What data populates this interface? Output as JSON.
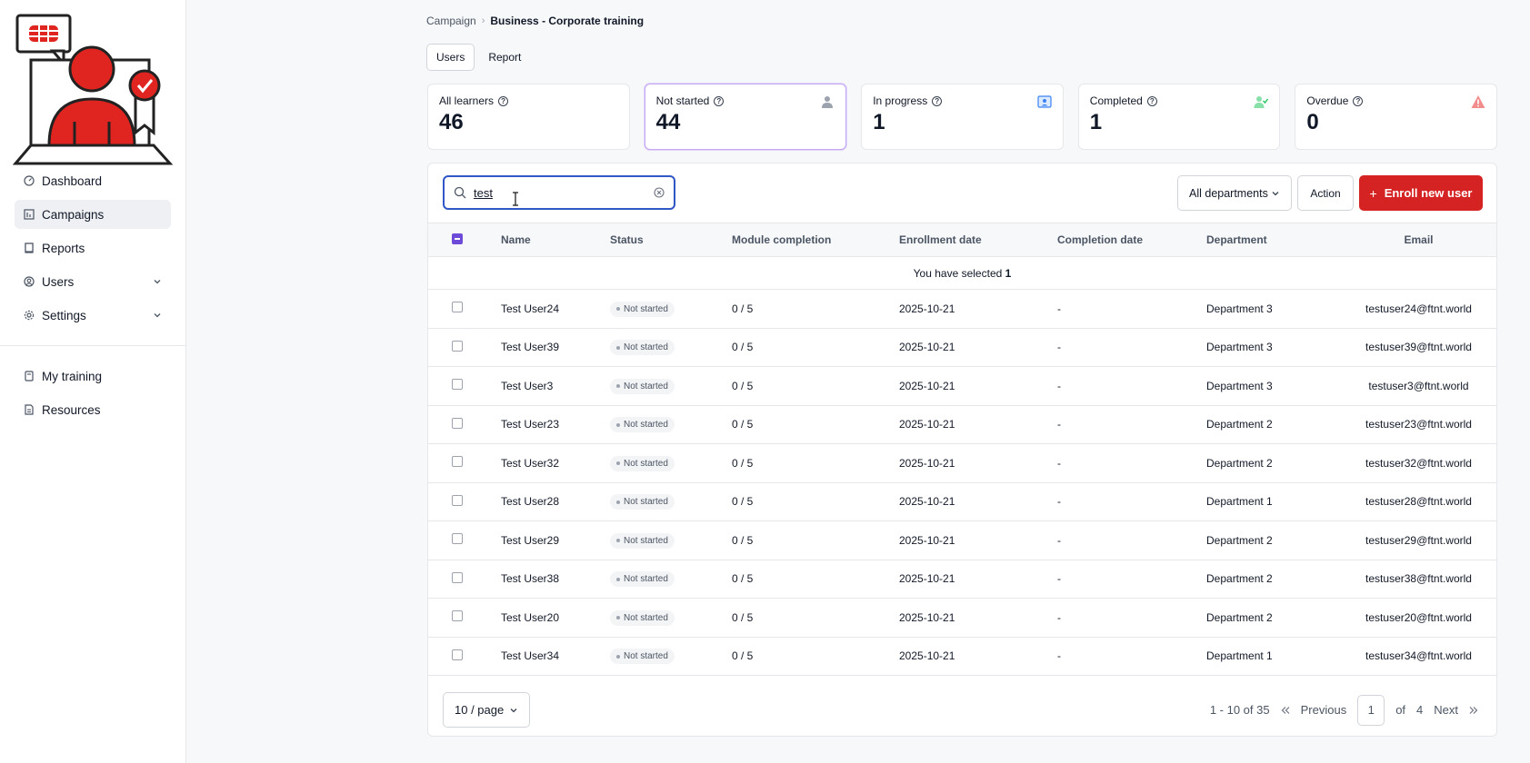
{
  "sidebar": {
    "items": [
      {
        "label": "Dashboard",
        "icon": "dashboard-icon"
      },
      {
        "label": "Campaigns",
        "icon": "campaigns-icon",
        "active": true
      },
      {
        "label": "Reports",
        "icon": "reports-icon"
      },
      {
        "label": "Users",
        "icon": "users-icon",
        "expandable": true
      },
      {
        "label": "Settings",
        "icon": "settings-icon",
        "expandable": true
      }
    ],
    "secondary": [
      {
        "label": "My training",
        "icon": "book-icon"
      },
      {
        "label": "Resources",
        "icon": "resources-icon"
      }
    ]
  },
  "breadcrumb": {
    "root": "Campaign",
    "current": "Business - Corporate training"
  },
  "tabs": [
    {
      "label": "Users",
      "active": true
    },
    {
      "label": "Report"
    }
  ],
  "stats": [
    {
      "label": "All learners",
      "value": "46"
    },
    {
      "label": "Not started",
      "value": "44",
      "icon": "user-icon"
    },
    {
      "label": "In progress",
      "value": "1",
      "icon": "user-card-icon"
    },
    {
      "label": "Completed",
      "value": "1",
      "icon": "user-check-icon"
    },
    {
      "label": "Overdue",
      "value": "0",
      "icon": "warning-icon"
    }
  ],
  "search": {
    "value": "test"
  },
  "filters": {
    "department": "All departments",
    "action": "Action",
    "enroll": "Enroll new user"
  },
  "table": {
    "columns": [
      "Name",
      "Status",
      "Module completion",
      "Enrollment date",
      "Completion date",
      "Department",
      "Email"
    ],
    "selection_prefix": "You have selected",
    "selection_count": "1",
    "rows": [
      {
        "name": "Test User24",
        "status": "Not started",
        "module": "0 / 5",
        "enroll": "2025-10-21",
        "completion": "-",
        "dept": "Department 3",
        "email": "testuser24@ftnt.world"
      },
      {
        "name": "Test User39",
        "status": "Not started",
        "module": "0 / 5",
        "enroll": "2025-10-21",
        "completion": "-",
        "dept": "Department 3",
        "email": "testuser39@ftnt.world"
      },
      {
        "name": "Test User3",
        "status": "Not started",
        "module": "0 / 5",
        "enroll": "2025-10-21",
        "completion": "-",
        "dept": "Department 3",
        "email": "testuser3@ftnt.world"
      },
      {
        "name": "Test User23",
        "status": "Not started",
        "module": "0 / 5",
        "enroll": "2025-10-21",
        "completion": "-",
        "dept": "Department 2",
        "email": "testuser23@ftnt.world"
      },
      {
        "name": "Test User32",
        "status": "Not started",
        "module": "0 / 5",
        "enroll": "2025-10-21",
        "completion": "-",
        "dept": "Department 2",
        "email": "testuser32@ftnt.world"
      },
      {
        "name": "Test User28",
        "status": "Not started",
        "module": "0 / 5",
        "enroll": "2025-10-21",
        "completion": "-",
        "dept": "Department 1",
        "email": "testuser28@ftnt.world"
      },
      {
        "name": "Test User29",
        "status": "Not started",
        "module": "0 / 5",
        "enroll": "2025-10-21",
        "completion": "-",
        "dept": "Department 2",
        "email": "testuser29@ftnt.world"
      },
      {
        "name": "Test User38",
        "status": "Not started",
        "module": "0 / 5",
        "enroll": "2025-10-21",
        "completion": "-",
        "dept": "Department 2",
        "email": "testuser38@ftnt.world"
      },
      {
        "name": "Test User20",
        "status": "Not started",
        "module": "0 / 5",
        "enroll": "2025-10-21",
        "completion": "-",
        "dept": "Department 2",
        "email": "testuser20@ftnt.world"
      },
      {
        "name": "Test User34",
        "status": "Not started",
        "module": "0 / 5",
        "enroll": "2025-10-21",
        "completion": "-",
        "dept": "Department 1",
        "email": "testuser34@ftnt.world"
      }
    ]
  },
  "pagination": {
    "page_size": "10 / page",
    "range": "1 - 10 of 35",
    "previous": "Previous",
    "current": "1",
    "of": "of",
    "total_pages": "4",
    "next": "Next"
  },
  "colors": {
    "accent": "#d42322",
    "selection": "#6d4bd8",
    "focus": "#3056c7"
  }
}
